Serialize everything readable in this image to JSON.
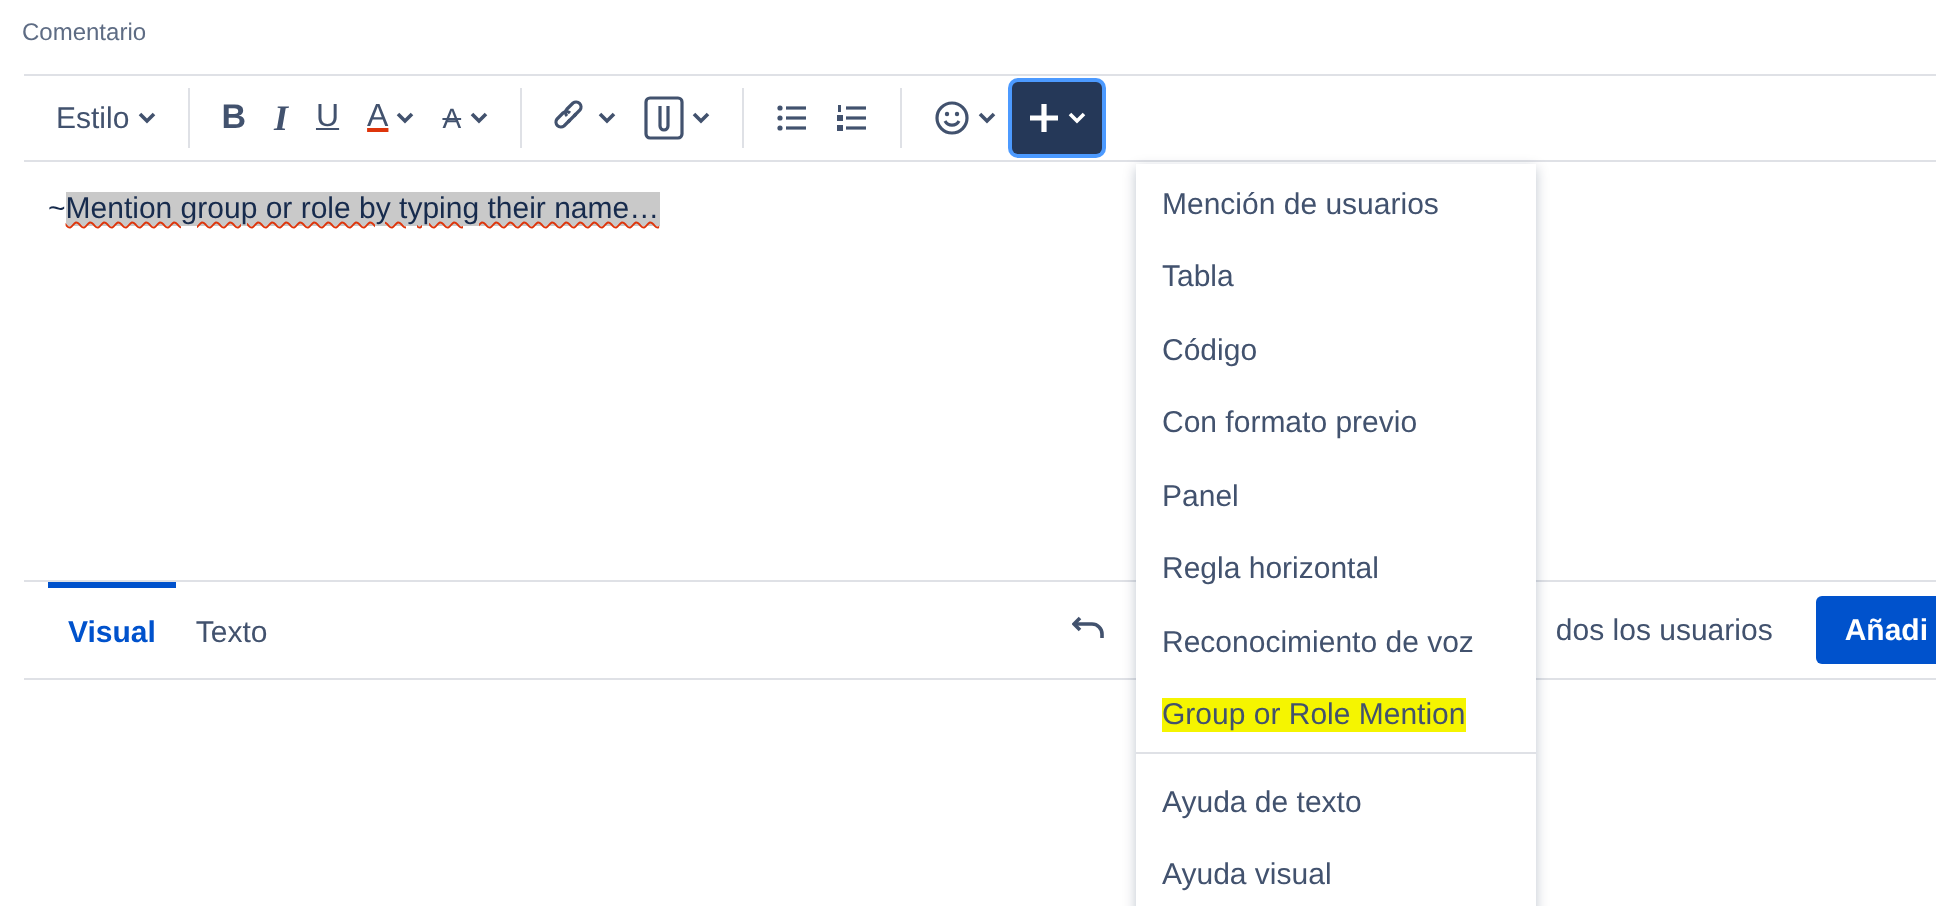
{
  "field_label": "Comentario",
  "toolbar": [
    [
      {
        "kind": "style",
        "label": "Estilo",
        "dropdown": true,
        "active": false
      }
    ],
    [
      {
        "kind": "bold",
        "label": "B",
        "dropdown": false,
        "active": false
      },
      {
        "kind": "italic",
        "label": "I",
        "dropdown": false,
        "active": false
      },
      {
        "kind": "underline",
        "label": "U",
        "dropdown": false,
        "active": false
      },
      {
        "kind": "color",
        "label": "A",
        "dropdown": true,
        "active": false
      },
      {
        "kind": "more-format",
        "label": "A",
        "dropdown": true,
        "active": false
      }
    ],
    [
      {
        "kind": "link",
        "dropdown": true,
        "active": false
      },
      {
        "kind": "attachment",
        "dropdown": true,
        "active": false
      }
    ],
    [
      {
        "kind": "bullet-list",
        "dropdown": false,
        "active": false
      },
      {
        "kind": "numbered-list",
        "dropdown": false,
        "active": false
      }
    ],
    [
      {
        "kind": "emoji",
        "dropdown": true,
        "active": false
      },
      {
        "kind": "insert",
        "dropdown": true,
        "active": true
      }
    ]
  ],
  "editor": {
    "prefix": "~",
    "selected_text": "Mention group or role by typing their name…"
  },
  "tabs": [
    {
      "label": "Visual",
      "selected": true
    },
    {
      "label": "Texto",
      "selected": false
    }
  ],
  "footer": {
    "visibility": "dos los usuarios",
    "submit": "Añadi"
  },
  "menu": {
    "sections": [
      [
        {
          "label": "Mención de usuarios",
          "highlighted": false
        },
        {
          "label": "Tabla",
          "highlighted": false
        },
        {
          "label": "Código",
          "highlighted": false
        },
        {
          "label": "Con formato previo",
          "highlighted": false
        },
        {
          "label": "Panel",
          "highlighted": false
        },
        {
          "label": "Regla horizontal",
          "highlighted": false
        },
        {
          "label": "Reconocimiento de voz",
          "highlighted": false
        },
        {
          "label": "Group or Role Mention",
          "highlighted": true
        }
      ],
      [
        {
          "label": "Ayuda de texto",
          "highlighted": false
        },
        {
          "label": "Ayuda visual",
          "highlighted": false
        }
      ]
    ]
  }
}
